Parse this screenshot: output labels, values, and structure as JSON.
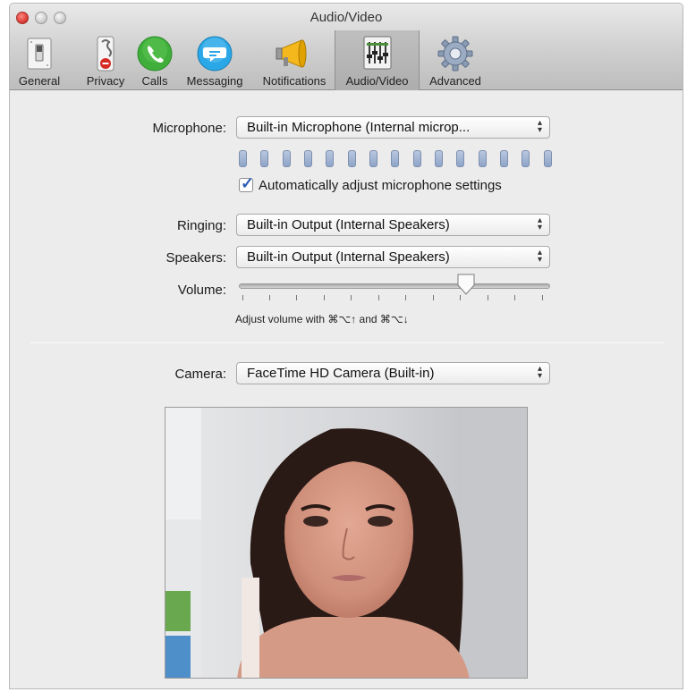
{
  "window": {
    "title": "Audio/Video"
  },
  "toolbar": {
    "items": [
      {
        "label": "General",
        "icon": "switch-icon"
      },
      {
        "label": "Privacy",
        "icon": "privacy-switch-icon"
      },
      {
        "label": "Calls",
        "icon": "phone-icon"
      },
      {
        "label": "Messaging",
        "icon": "speech-bubble-icon"
      },
      {
        "label": "Notifications",
        "icon": "megaphone-icon"
      },
      {
        "label": "Audio/Video",
        "icon": "mixer-icon",
        "selected": true
      },
      {
        "label": "Advanced",
        "icon": "gear-icon"
      }
    ]
  },
  "audio": {
    "microphone_label": "Microphone:",
    "microphone_value": "Built-in Microphone (Internal microp...",
    "auto_adjust_label": "Automatically adjust microphone settings",
    "auto_adjust_checked": true,
    "ringing_label": "Ringing:",
    "ringing_value": "Built-in Output (Internal Speakers)",
    "speakers_label": "Speakers:",
    "speakers_value": "Built-in Output (Internal Speakers)",
    "volume_label": "Volume:",
    "volume_level": 0.73,
    "volume_hint": "Adjust volume with ⌘⌥↑ and ⌘⌥↓"
  },
  "video": {
    "camera_label": "Camera:",
    "camera_value": "FaceTime HD Camera (Built-in)"
  },
  "colors": {
    "accent": "#2b5fb8",
    "toolbar_bg": "#cfcfcf",
    "window_bg": "#ececec",
    "calls_green": "#3fae3a",
    "messaging_blue": "#2aa7e6"
  }
}
